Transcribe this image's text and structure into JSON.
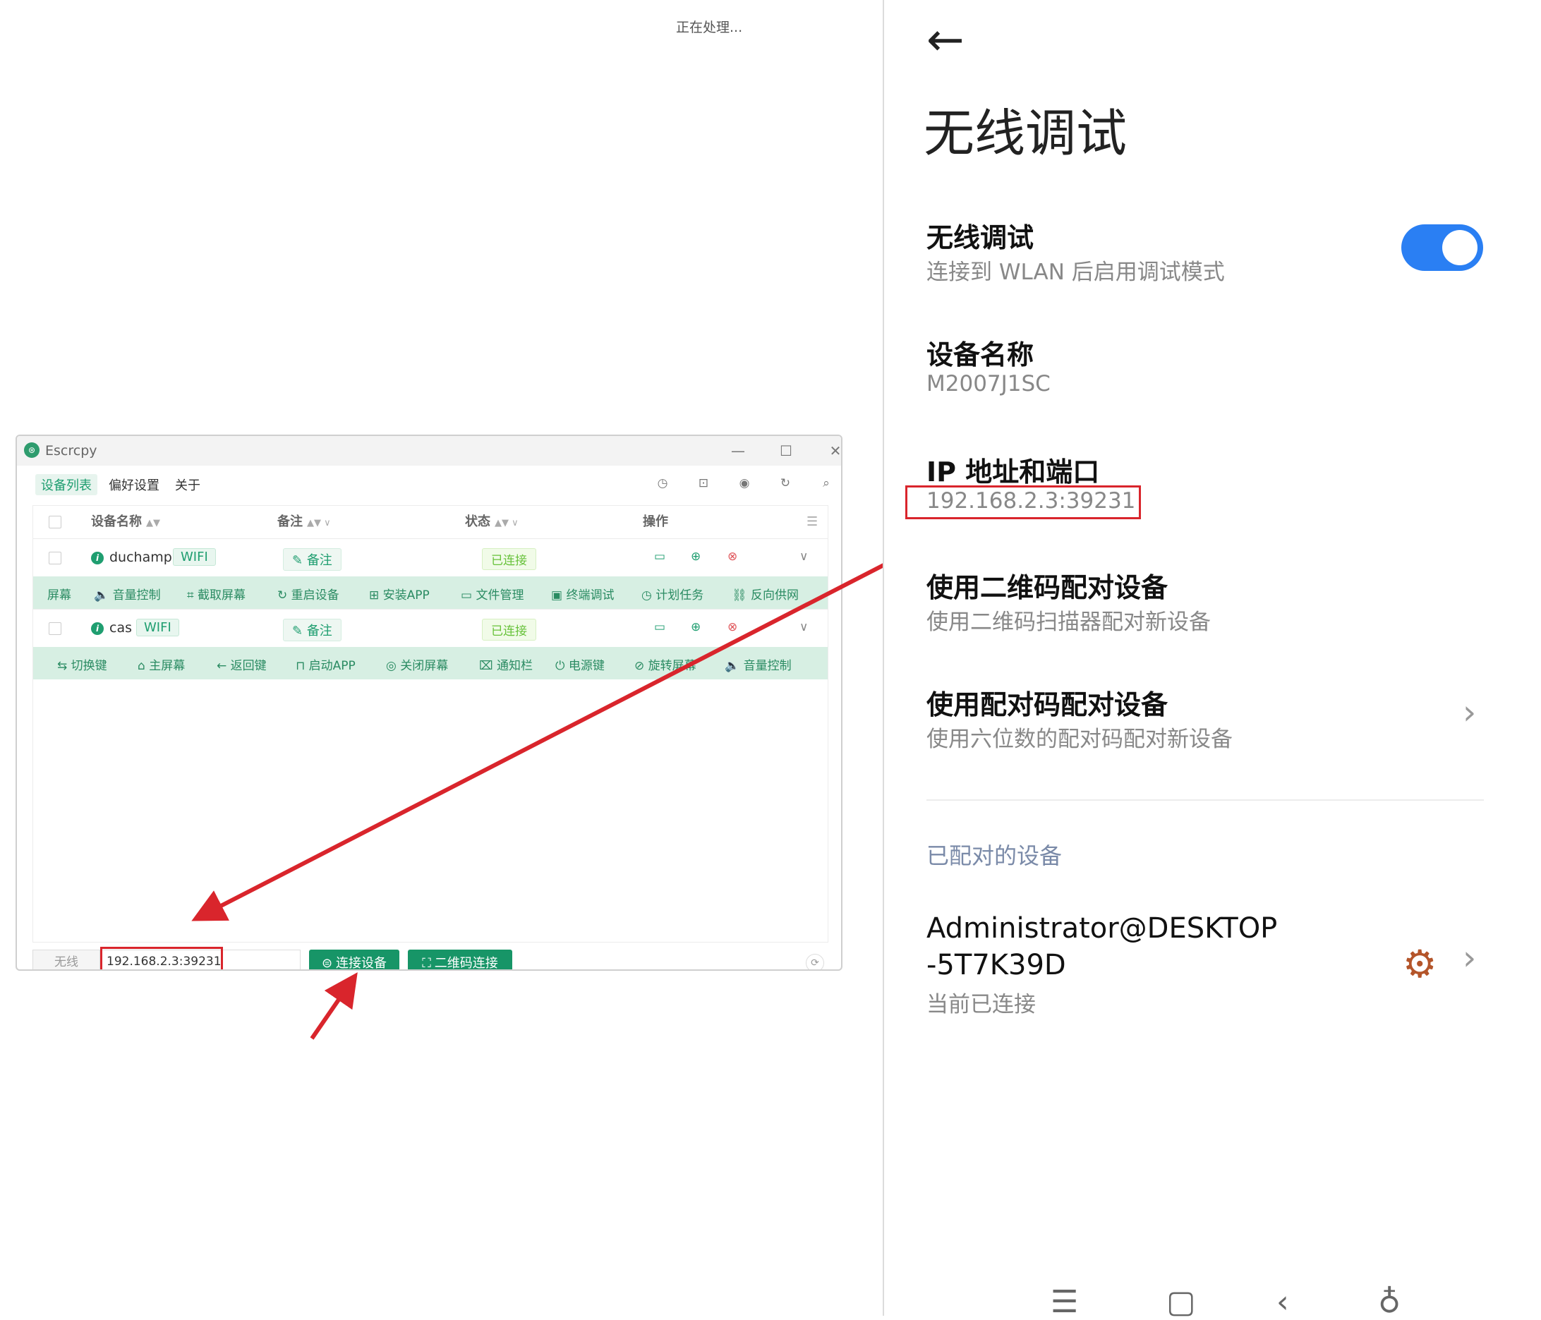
{
  "processing_text": "正在处理...",
  "app": {
    "title": "Escrcpy",
    "menu": [
      "设备列表",
      "偏好设置",
      "关于"
    ],
    "columns": {
      "name": "设备名称",
      "remark": "备注",
      "status": "状态",
      "ops": "操作"
    },
    "devices": [
      {
        "name": "duchamp",
        "type": "WIFI",
        "remark": "备注",
        "status": "已连接",
        "actions": [
          "屏幕",
          "音量控制",
          "截取屏幕",
          "重启设备",
          "安装APP",
          "文件管理",
          "终端调试",
          "计划任务",
          "反向供网"
        ]
      },
      {
        "name": "cas",
        "type": "WIFI",
        "remark": "备注",
        "status": "已连接",
        "actions": [
          "切换键",
          "主屏幕",
          "返回键",
          "启动APP",
          "关闭屏幕",
          "通知栏",
          "电源键",
          "旋转屏幕",
          "音量控制"
        ]
      }
    ],
    "bottom": {
      "mode_label": "无线",
      "ip_value": "192.168.2.3:39231",
      "connect_label": "连接设备",
      "qr_label": "二维码连接"
    }
  },
  "phone": {
    "title": "无线调试",
    "wireless": {
      "title": "无线调试",
      "subtitle": "连接到 WLAN 后启用调试模式",
      "enabled": true,
      "accent": "#2a7ff3"
    },
    "device_name": {
      "title": "设备名称",
      "value": "M2007J1SC"
    },
    "ip_port": {
      "title": "IP 地址和端口",
      "value": "192.168.2.3:39231"
    },
    "qr_pair": {
      "title": "使用二维码配对设备",
      "subtitle": "使用二维码扫描器配对新设备"
    },
    "code_pair": {
      "title": "使用配对码配对设备",
      "subtitle": "使用六位数的配对码配对新设备"
    },
    "paired_header": "已配对的设备",
    "paired_device": {
      "name_line1": "Administrator@DESKTOP",
      "name_line2": "-5T7K39D",
      "status": "当前已连接"
    }
  },
  "colors": {
    "highlight_red": "#d9252c",
    "brand_green": "#179567"
  }
}
